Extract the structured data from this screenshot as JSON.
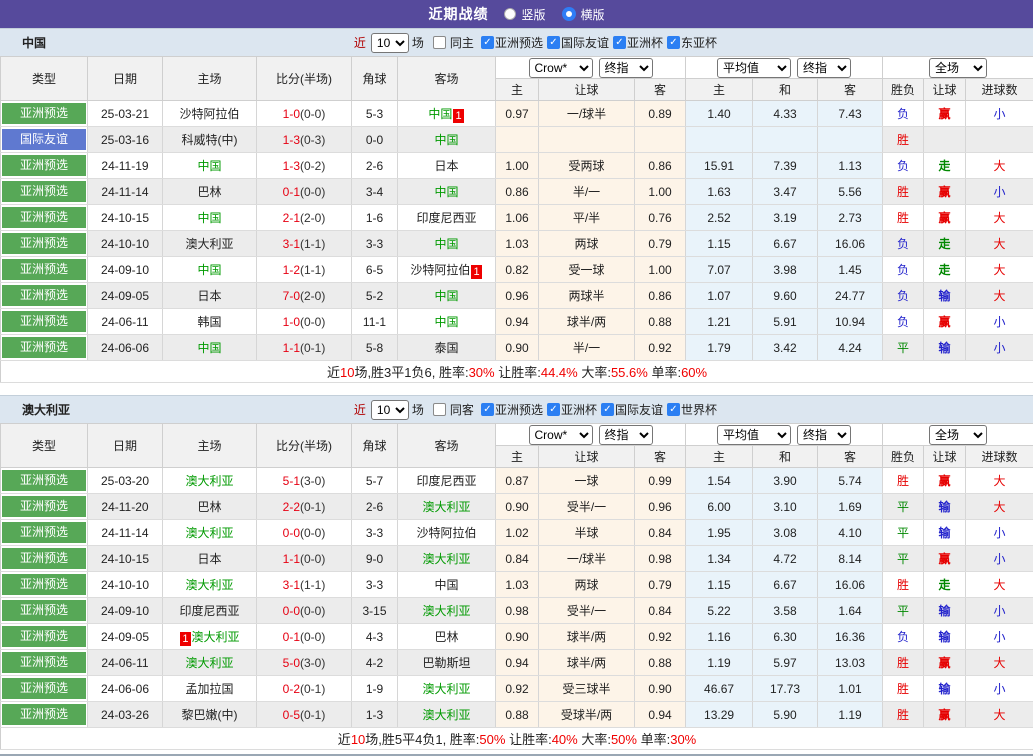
{
  "topbar": {
    "title": "近期战绩",
    "vertical": {
      "label": "竖版",
      "selected": false
    },
    "horizontal": {
      "label": "横版",
      "selected": true
    }
  },
  "colors": {
    "topbar_purple": "#564a9c",
    "badge_green": "#57a857",
    "badge_blue": "#5f79d0",
    "team_green": "#009a00",
    "result_red": "#e60000",
    "result_blue": "#2323cc",
    "result_green": "#008800",
    "odds_column_bg": "#fdf4e8",
    "avg_column_bg": "#e9f3fa",
    "checkbox_blue": "#2b7ff3",
    "score_red": "#e60012"
  },
  "header": {
    "near": "近",
    "count": "10",
    "field": "场",
    "cols": [
      "类型",
      "日期",
      "主场",
      "比分(半场)",
      "角球",
      "客场"
    ],
    "crow": "Crow*",
    "final": "终指",
    "average": "平均值",
    "final2": "终指",
    "full": "全场",
    "sub": [
      "主",
      "让球",
      "客",
      "主",
      "和",
      "客",
      "胜负",
      "让球",
      "进球数"
    ]
  },
  "tables": [
    {
      "team": "中国",
      "same": {
        "label": "同主",
        "checked": false
      },
      "comps": [
        {
          "label": "亚洲预选",
          "checked": true
        },
        {
          "label": "国际友谊",
          "checked": true
        },
        {
          "label": "亚洲杯",
          "checked": true
        },
        {
          "label": "东亚杯",
          "checked": true
        }
      ],
      "rows": [
        {
          "type": "亚洲预选",
          "tc": "green",
          "date": "25-03-21",
          "home": {
            "n": "沙特阿拉伯"
          },
          "ft": "1-0",
          "ht": "(0-0)",
          "corner": "5-3",
          "away": {
            "n": "中国",
            "g": true,
            "b": "1",
            "bp": "after"
          },
          "odds": [
            "0.97",
            "一/球半",
            "0.89"
          ],
          "avg": [
            "1.40",
            "4.33",
            "7.43"
          ],
          "res": [
            "负",
            "blue"
          ],
          "hand": [
            "赢",
            "red"
          ],
          "goal": [
            "小",
            "blue"
          ]
        },
        {
          "type": "国际友谊",
          "tc": "blue",
          "date": "25-03-16",
          "home": {
            "n": "科威特(中)"
          },
          "ft": "1-3",
          "ht": "(0-3)",
          "corner": "0-0",
          "away": {
            "n": "中国",
            "g": true
          },
          "odds": [
            "",
            "",
            ""
          ],
          "avg": [
            "",
            "",
            ""
          ],
          "res": [
            "胜",
            "red"
          ],
          "hand": [
            "",
            ""
          ],
          "goal": [
            "",
            ""
          ]
        },
        {
          "type": "亚洲预选",
          "tc": "green",
          "date": "24-11-19",
          "home": {
            "n": "中国",
            "g": true
          },
          "ft": "1-3",
          "ht": "(0-2)",
          "corner": "2-6",
          "away": {
            "n": "日本"
          },
          "odds": [
            "1.00",
            "受两球",
            "0.86"
          ],
          "avg": [
            "15.91",
            "7.39",
            "1.13"
          ],
          "res": [
            "负",
            "blue"
          ],
          "hand": [
            "走",
            "green"
          ],
          "goal": [
            "大",
            "red"
          ]
        },
        {
          "type": "亚洲预选",
          "tc": "green",
          "date": "24-11-14",
          "home": {
            "n": "巴林"
          },
          "ft": "0-1",
          "ht": "(0-0)",
          "corner": "3-4",
          "away": {
            "n": "中国",
            "g": true
          },
          "odds": [
            "0.86",
            "半/一",
            "1.00"
          ],
          "avg": [
            "1.63",
            "3.47",
            "5.56"
          ],
          "res": [
            "胜",
            "red"
          ],
          "hand": [
            "赢",
            "red"
          ],
          "goal": [
            "小",
            "blue"
          ]
        },
        {
          "type": "亚洲预选",
          "tc": "green",
          "date": "24-10-15",
          "home": {
            "n": "中国",
            "g": true
          },
          "ft": "2-1",
          "ht": "(2-0)",
          "corner": "1-6",
          "away": {
            "n": "印度尼西亚"
          },
          "odds": [
            "1.06",
            "平/半",
            "0.76"
          ],
          "avg": [
            "2.52",
            "3.19",
            "2.73"
          ],
          "res": [
            "胜",
            "red"
          ],
          "hand": [
            "赢",
            "red"
          ],
          "goal": [
            "大",
            "red"
          ]
        },
        {
          "type": "亚洲预选",
          "tc": "green",
          "date": "24-10-10",
          "home": {
            "n": "澳大利亚"
          },
          "ft": "3-1",
          "ht": "(1-1)",
          "corner": "3-3",
          "away": {
            "n": "中国",
            "g": true
          },
          "odds": [
            "1.03",
            "两球",
            "0.79"
          ],
          "avg": [
            "1.15",
            "6.67",
            "16.06"
          ],
          "res": [
            "负",
            "blue"
          ],
          "hand": [
            "走",
            "green"
          ],
          "goal": [
            "大",
            "red"
          ]
        },
        {
          "type": "亚洲预选",
          "tc": "green",
          "date": "24-09-10",
          "home": {
            "n": "中国",
            "g": true
          },
          "ft": "1-2",
          "ht": "(1-1)",
          "corner": "6-5",
          "away": {
            "n": "沙特阿拉伯",
            "b": "1",
            "bp": "after"
          },
          "odds": [
            "0.82",
            "受一球",
            "1.00"
          ],
          "avg": [
            "7.07",
            "3.98",
            "1.45"
          ],
          "res": [
            "负",
            "blue"
          ],
          "hand": [
            "走",
            "green"
          ],
          "goal": [
            "大",
            "red"
          ]
        },
        {
          "type": "亚洲预选",
          "tc": "green",
          "date": "24-09-05",
          "home": {
            "n": "日本"
          },
          "ft": "7-0",
          "ht": "(2-0)",
          "corner": "5-2",
          "away": {
            "n": "中国",
            "g": true
          },
          "odds": [
            "0.96",
            "两球半",
            "0.86"
          ],
          "avg": [
            "1.07",
            "9.60",
            "24.77"
          ],
          "res": [
            "负",
            "blue"
          ],
          "hand": [
            "输",
            "blue"
          ],
          "goal": [
            "大",
            "red"
          ]
        },
        {
          "type": "亚洲预选",
          "tc": "green",
          "date": "24-06-11",
          "home": {
            "n": "韩国"
          },
          "ft": "1-0",
          "ht": "(0-0)",
          "corner": "11-1",
          "away": {
            "n": "中国",
            "g": true
          },
          "odds": [
            "0.94",
            "球半/两",
            "0.88"
          ],
          "avg": [
            "1.21",
            "5.91",
            "10.94"
          ],
          "res": [
            "负",
            "blue"
          ],
          "hand": [
            "赢",
            "red"
          ],
          "goal": [
            "小",
            "blue"
          ]
        },
        {
          "type": "亚洲预选",
          "tc": "green",
          "date": "24-06-06",
          "home": {
            "n": "中国",
            "g": true
          },
          "ft": "1-1",
          "ht": "(0-1)",
          "corner": "5-8",
          "away": {
            "n": "泰国"
          },
          "odds": [
            "0.90",
            "半/一",
            "0.92"
          ],
          "avg": [
            "1.79",
            "3.42",
            "4.24"
          ],
          "res": [
            "平",
            "green"
          ],
          "hand": [
            "输",
            "blue"
          ],
          "goal": [
            "小",
            "blue"
          ]
        }
      ],
      "summary": [
        {
          "text": "近",
          "red": false
        },
        {
          "text": "10",
          "red": true
        },
        {
          "text": "场,胜3平1负6, 胜率:",
          "red": false
        },
        {
          "text": "30%",
          "red": true
        },
        {
          "text": " 让胜率:",
          "red": false
        },
        {
          "text": "44.4%",
          "red": true
        },
        {
          "text": " 大率:",
          "red": false
        },
        {
          "text": "55.6%",
          "red": true
        },
        {
          "text": " 单率:",
          "red": false
        },
        {
          "text": "60%",
          "red": true
        }
      ]
    },
    {
      "team": "澳大利亚",
      "same": {
        "label": "同客",
        "checked": false
      },
      "comps": [
        {
          "label": "亚洲预选",
          "checked": true
        },
        {
          "label": "亚洲杯",
          "checked": true
        },
        {
          "label": "国际友谊",
          "checked": true
        },
        {
          "label": "世界杯",
          "checked": true
        }
      ],
      "rows": [
        {
          "type": "亚洲预选",
          "tc": "green",
          "date": "25-03-20",
          "home": {
            "n": "澳大利亚",
            "g": true
          },
          "ft": "5-1",
          "ht": "(3-0)",
          "corner": "5-7",
          "away": {
            "n": "印度尼西亚"
          },
          "odds": [
            "0.87",
            "一球",
            "0.99"
          ],
          "avg": [
            "1.54",
            "3.90",
            "5.74"
          ],
          "res": [
            "胜",
            "red"
          ],
          "hand": [
            "赢",
            "red"
          ],
          "goal": [
            "大",
            "red"
          ]
        },
        {
          "type": "亚洲预选",
          "tc": "green",
          "date": "24-11-20",
          "home": {
            "n": "巴林"
          },
          "ft": "2-2",
          "ht": "(0-1)",
          "corner": "2-6",
          "away": {
            "n": "澳大利亚",
            "g": true
          },
          "odds": [
            "0.90",
            "受半/一",
            "0.96"
          ],
          "avg": [
            "6.00",
            "3.10",
            "1.69"
          ],
          "res": [
            "平",
            "green"
          ],
          "hand": [
            "输",
            "blue"
          ],
          "goal": [
            "大",
            "red"
          ]
        },
        {
          "type": "亚洲预选",
          "tc": "green",
          "date": "24-11-14",
          "home": {
            "n": "澳大利亚",
            "g": true
          },
          "ft": "0-0",
          "ht": "(0-0)",
          "corner": "3-3",
          "away": {
            "n": "沙特阿拉伯"
          },
          "odds": [
            "1.02",
            "半球",
            "0.84"
          ],
          "avg": [
            "1.95",
            "3.08",
            "4.10"
          ],
          "res": [
            "平",
            "green"
          ],
          "hand": [
            "输",
            "blue"
          ],
          "goal": [
            "小",
            "blue"
          ]
        },
        {
          "type": "亚洲预选",
          "tc": "green",
          "date": "24-10-15",
          "home": {
            "n": "日本"
          },
          "ft": "1-1",
          "ht": "(0-0)",
          "corner": "9-0",
          "away": {
            "n": "澳大利亚",
            "g": true
          },
          "odds": [
            "0.84",
            "一/球半",
            "0.98"
          ],
          "avg": [
            "1.34",
            "4.72",
            "8.14"
          ],
          "res": [
            "平",
            "green"
          ],
          "hand": [
            "赢",
            "red"
          ],
          "goal": [
            "小",
            "blue"
          ]
        },
        {
          "type": "亚洲预选",
          "tc": "green",
          "date": "24-10-10",
          "home": {
            "n": "澳大利亚",
            "g": true
          },
          "ft": "3-1",
          "ht": "(1-1)",
          "corner": "3-3",
          "away": {
            "n": "中国"
          },
          "odds": [
            "1.03",
            "两球",
            "0.79"
          ],
          "avg": [
            "1.15",
            "6.67",
            "16.06"
          ],
          "res": [
            "胜",
            "red"
          ],
          "hand": [
            "走",
            "green"
          ],
          "goal": [
            "大",
            "red"
          ]
        },
        {
          "type": "亚洲预选",
          "tc": "green",
          "date": "24-09-10",
          "home": {
            "n": "印度尼西亚"
          },
          "ft": "0-0",
          "ht": "(0-0)",
          "corner": "3-15",
          "away": {
            "n": "澳大利亚",
            "g": true
          },
          "odds": [
            "0.98",
            "受半/一",
            "0.84"
          ],
          "avg": [
            "5.22",
            "3.58",
            "1.64"
          ],
          "res": [
            "平",
            "green"
          ],
          "hand": [
            "输",
            "blue"
          ],
          "goal": [
            "小",
            "blue"
          ]
        },
        {
          "type": "亚洲预选",
          "tc": "green",
          "date": "24-09-05",
          "home": {
            "n": "澳大利亚",
            "g": true,
            "b": "1",
            "bp": "before"
          },
          "ft": "0-1",
          "ht": "(0-0)",
          "corner": "4-3",
          "away": {
            "n": "巴林"
          },
          "odds": [
            "0.90",
            "球半/两",
            "0.92"
          ],
          "avg": [
            "1.16",
            "6.30",
            "16.36"
          ],
          "res": [
            "负",
            "blue"
          ],
          "hand": [
            "输",
            "blue"
          ],
          "goal": [
            "小",
            "blue"
          ]
        },
        {
          "type": "亚洲预选",
          "tc": "green",
          "date": "24-06-11",
          "home": {
            "n": "澳大利亚",
            "g": true
          },
          "ft": "5-0",
          "ht": "(3-0)",
          "corner": "4-2",
          "away": {
            "n": "巴勒斯坦"
          },
          "odds": [
            "0.94",
            "球半/两",
            "0.88"
          ],
          "avg": [
            "1.19",
            "5.97",
            "13.03"
          ],
          "res": [
            "胜",
            "red"
          ],
          "hand": [
            "赢",
            "red"
          ],
          "goal": [
            "大",
            "red"
          ]
        },
        {
          "type": "亚洲预选",
          "tc": "green",
          "date": "24-06-06",
          "home": {
            "n": "孟加拉国"
          },
          "ft": "0-2",
          "ht": "(0-1)",
          "corner": "1-9",
          "away": {
            "n": "澳大利亚",
            "g": true
          },
          "odds": [
            "0.92",
            "受三球半",
            "0.90"
          ],
          "avg": [
            "46.67",
            "17.73",
            "1.01"
          ],
          "res": [
            "胜",
            "red"
          ],
          "hand": [
            "输",
            "blue"
          ],
          "goal": [
            "小",
            "blue"
          ]
        },
        {
          "type": "亚洲预选",
          "tc": "green",
          "date": "24-03-26",
          "home": {
            "n": "黎巴嫩(中)"
          },
          "ft": "0-5",
          "ht": "(0-1)",
          "corner": "1-3",
          "away": {
            "n": "澳大利亚",
            "g": true
          },
          "odds": [
            "0.88",
            "受球半/两",
            "0.94"
          ],
          "avg": [
            "13.29",
            "5.90",
            "1.19"
          ],
          "res": [
            "胜",
            "red"
          ],
          "hand": [
            "赢",
            "red"
          ],
          "goal": [
            "大",
            "red"
          ]
        }
      ],
      "summary": [
        {
          "text": "近",
          "red": false
        },
        {
          "text": "10",
          "red": true
        },
        {
          "text": "场,胜5平4负1, 胜率:",
          "red": false
        },
        {
          "text": "50%",
          "red": true
        },
        {
          "text": " 让胜率:",
          "red": false
        },
        {
          "text": "40%",
          "red": true
        },
        {
          "text": " 大率:",
          "red": false
        },
        {
          "text": "50%",
          "red": true
        },
        {
          "text": " 单率:",
          "red": false
        },
        {
          "text": "30%",
          "red": true
        }
      ]
    }
  ]
}
